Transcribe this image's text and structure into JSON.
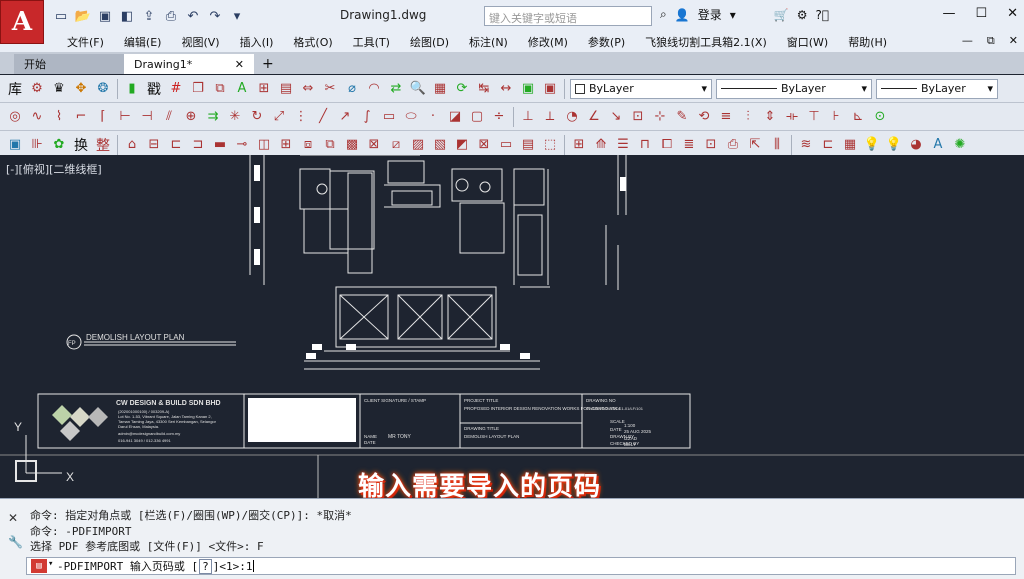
{
  "app": {
    "logo_letter": "A",
    "doc_title": "Drawing1.dwg"
  },
  "search": {
    "placeholder": "键入关键字或短语"
  },
  "account": {
    "login_label": "登录"
  },
  "menu": [
    "文件(F)",
    "编辑(E)",
    "视图(V)",
    "插入(I)",
    "格式(O)",
    "工具(T)",
    "绘图(D)",
    "标注(N)",
    "修改(M)",
    "参数(P)",
    "飞狼线切割工具箱2.1(X)",
    "窗口(W)",
    "帮助(H)"
  ],
  "tabs": {
    "start": "开始",
    "active": "Drawing1*"
  },
  "toolbar1": {
    "kanji": "库",
    "kanji2": "戳"
  },
  "toolbar3": {
    "kanji": "换",
    "kanji2": "整"
  },
  "properties": {
    "color": "ByLayer",
    "linetype": "ByLayer",
    "lineweight": "ByLayer"
  },
  "viewport": {
    "label": "[-][俯视][二维线框]"
  },
  "drawing": {
    "plan_label": "DEMOLISH LAYOUT PLAN",
    "plan_tag": "FP",
    "company": "CW DESIGN & BUILD SDN BHD",
    "company_lines": [
      "(202001000100) / 003209-A)",
      "Lot No. 1-53, Vibrant Square, Jalan Taming Kanan 2,",
      "Taman Taming Jaya, 43300 Seri Kembangan, Selangor",
      "Darul Ehsan, Malaysia.",
      "admin@mcdesignandbuild.com.my",
      "016-941 3049 / 012-336 4991"
    ],
    "client_sig": "CLIENT SIGNATURE / STAMP",
    "name_label": "NAME",
    "name_value": "MR TONY",
    "date_label": "DATE",
    "project_title_label": "PROJECT TITLE",
    "project_title": "PROPOSED INTERIOR DESIGN RENOVATION WORKS FOR CONDO ATK.L",
    "drawing_title_label": "DRAWING TITLE",
    "drawing_title": "DEMOLISH LAYOUT PLAN",
    "drawing_no_label": "DRAWING NO",
    "drawing_no": "CWDB/FR/2023/DE1-01/LF/101",
    "scale_label": "SCALE",
    "scale": "1:100",
    "date2_label": "DATE",
    "date2": "25 AUG 2025",
    "drawn_label": "DRAWN BY",
    "drawn": "IZZAD",
    "checked_label": "CHECKED BY",
    "checked": "BILLY",
    "ucs_y": "Y",
    "ucs_x": "X"
  },
  "caption": "输入需要导入的页码",
  "command": {
    "history": [
      "命令: 指定对角点或 [栏选(F)/圈围(WP)/圈交(CP)]: *取消*",
      "命令: -PDFIMPORT",
      "选择 PDF 参考底图或 [文件(F)] <文件>: F"
    ],
    "prompt_prefix": "-PDFIMPORT 输入页码或 [",
    "prompt_option": "?",
    "prompt_suffix": "]<1>:",
    "input_value": "1"
  }
}
